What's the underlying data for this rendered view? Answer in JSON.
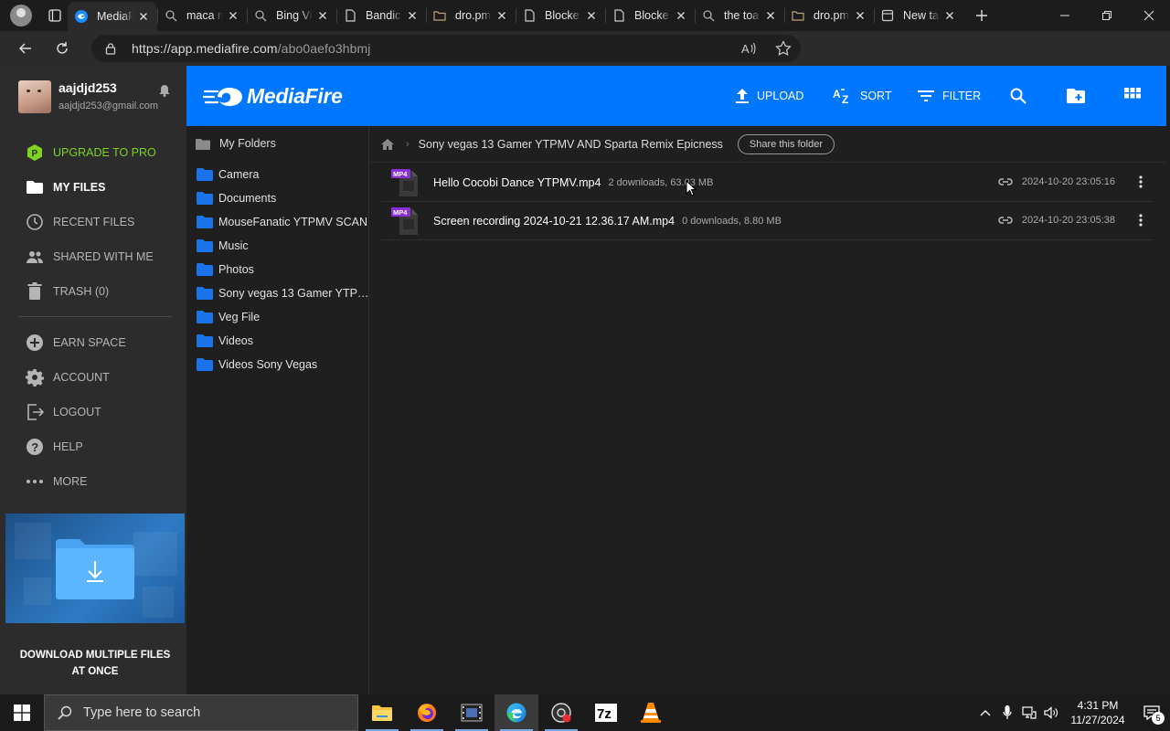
{
  "browser": {
    "tabs": [
      {
        "title": "MediaFire",
        "active": true,
        "icon": "mediafire-icon"
      },
      {
        "title": "maca m",
        "icon": "search-icon"
      },
      {
        "title": "Bing Vi",
        "icon": "search-icon"
      },
      {
        "title": "Bandic",
        "icon": "page-icon"
      },
      {
        "title": "dro.pm",
        "icon": "folder-icon"
      },
      {
        "title": "Blocke",
        "icon": "page-icon"
      },
      {
        "title": "Blocke",
        "icon": "page-icon"
      },
      {
        "title": "the toa",
        "icon": "search-icon"
      },
      {
        "title": "dro.pm",
        "icon": "folder-icon"
      },
      {
        "title": "New ta",
        "icon": "newtab-icon"
      }
    ],
    "url_host": "https://app.mediafire.com",
    "url_path": "/abo0aefo3hbmj"
  },
  "sidebar": {
    "username": "aajdjd253",
    "email": "aajdjd253@gmail.com",
    "upgrade": "UPGRADE TO PRO",
    "my_files": "MY FILES",
    "recent_files": "RECENT FILES",
    "shared": "SHARED WITH ME",
    "trash": "TRASH (0)",
    "earn_space": "EARN SPACE",
    "account": "ACCOUNT",
    "logout": "LOGOUT",
    "help": "HELP",
    "more": "MORE",
    "promo": "DOWNLOAD MULTIPLE FILES AT ONCE"
  },
  "header": {
    "logo": "MediaFire",
    "upload": "UPLOAD",
    "sort": "SORT",
    "filter": "FILTER"
  },
  "tree": {
    "heading": "My Folders",
    "folders": [
      "Camera",
      "Documents",
      "MouseFanatic YTPMV SCAN",
      "Music",
      "Photos",
      "Sony vegas 13 Gamer YTP…",
      "Veg File",
      "Videos",
      "Videos Sony Vegas"
    ]
  },
  "main": {
    "breadcrumb": "Sony vegas 13 Gamer YTPMV AND Sparta Remix Epicness",
    "share": "Share this folder",
    "files": [
      {
        "type": "MP4",
        "name": "Hello Cocobi Dance YTPMV.mp4",
        "meta": "2 downloads, 63.03 MB",
        "date": "2024-10-20 23:05:16"
      },
      {
        "type": "MP4",
        "name": "Screen recording 2024-10-21 12.36.17 AM.mp4",
        "meta": "0 downloads, 8.80 MB",
        "date": "2024-10-20 23:05:38"
      }
    ]
  },
  "taskbar": {
    "search_placeholder": "Type here to search",
    "time": "4:31 PM",
    "date": "11/27/2024",
    "notifications": "5"
  },
  "colors": {
    "brand_blue": "#0077ff",
    "folder_blue": "#1a73e8",
    "pro_green": "#7ed321",
    "mp4_purple": "#8b2fd6"
  }
}
